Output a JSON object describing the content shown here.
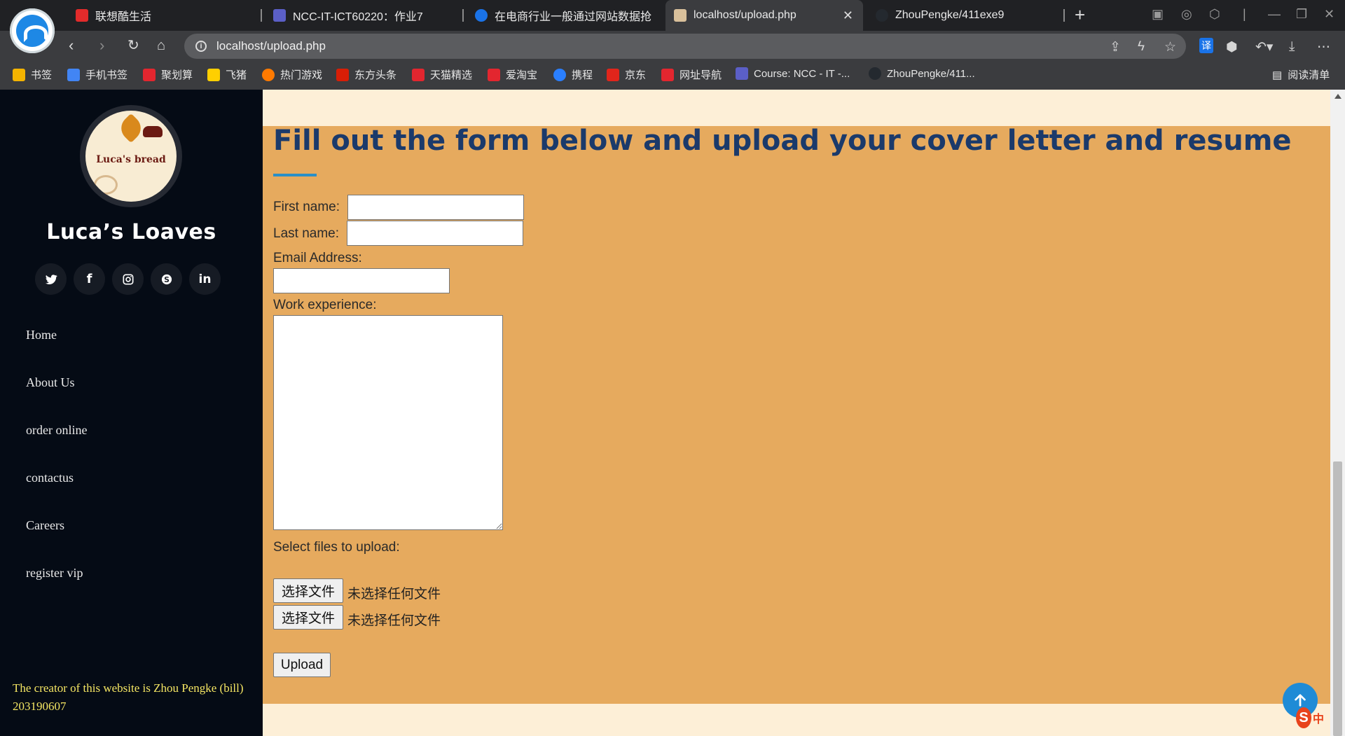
{
  "browser": {
    "tabs": [
      {
        "title": "联想酷生活",
        "favicon_color": "#e32b2b"
      },
      {
        "title": "NCC-IT-ICT60220：作业7",
        "favicon_color": "#5b5fc7"
      },
      {
        "title": "在电商行业一般通过网站数据抢",
        "favicon_color": "#1a73e8"
      },
      {
        "title": "localhost/upload.php",
        "favicon_color": "#d9c09b"
      },
      {
        "title": "ZhouPengke/411exe9",
        "favicon_color": "#24292f"
      }
    ],
    "active_tab_index": 3,
    "url": "localhost/upload.php",
    "bookmarks": [
      {
        "label": "书签",
        "color": "#f4b400"
      },
      {
        "label": "手机书签",
        "color": "#4285f4"
      },
      {
        "label": "聚划算",
        "color": "#e3262f"
      },
      {
        "label": "飞猪",
        "color": "#ffcf00"
      },
      {
        "label": "热门游戏",
        "color": "#ff7a00"
      },
      {
        "label": "东方头条",
        "color": "#d81e06"
      },
      {
        "label": "天猫精选",
        "color": "#e3262f"
      },
      {
        "label": "爱淘宝",
        "color": "#e3262f"
      },
      {
        "label": "携程",
        "color": "#2a7fff"
      },
      {
        "label": "京东",
        "color": "#e1251b"
      },
      {
        "label": "网址导航",
        "color": "#e3262f"
      },
      {
        "label": "Course: NCC - IT -...",
        "color": "#5b5fc7"
      },
      {
        "label": "ZhouPengke/411...",
        "color": "#24292f"
      }
    ],
    "reading_list": "阅读清单",
    "translate_badge": "译"
  },
  "sidebar": {
    "logo_text": "Luca's bread",
    "site_name": "Luca’s Loaves",
    "socials": [
      "twitter-icon",
      "facebook-icon",
      "instagram-icon",
      "skype-icon",
      "linkedin-icon"
    ],
    "menu": [
      "Home",
      "About Us",
      "order online",
      "contactus",
      "Careers",
      "register vip"
    ],
    "creator": "The creator of this website is Zhou Pengke (bill) 203190607"
  },
  "form": {
    "heading": "Fill out the form below and upload your cover letter and resume",
    "first_name_label": "First name:",
    "last_name_label": "Last name:",
    "email_label": "Email Address:",
    "work_label": "Work experience:",
    "files_label": "Select files to upload:",
    "file_button": "选择文件",
    "no_file": "未选择任何文件",
    "upload": "Upload"
  },
  "colors": {
    "panel": "#e6aa5e",
    "page_bg": "#fdefd7",
    "sidebar": "#050b15",
    "heading": "#1b3a6b",
    "creator": "#f5e663"
  },
  "ime": {
    "logo": "S",
    "mode": "中"
  }
}
